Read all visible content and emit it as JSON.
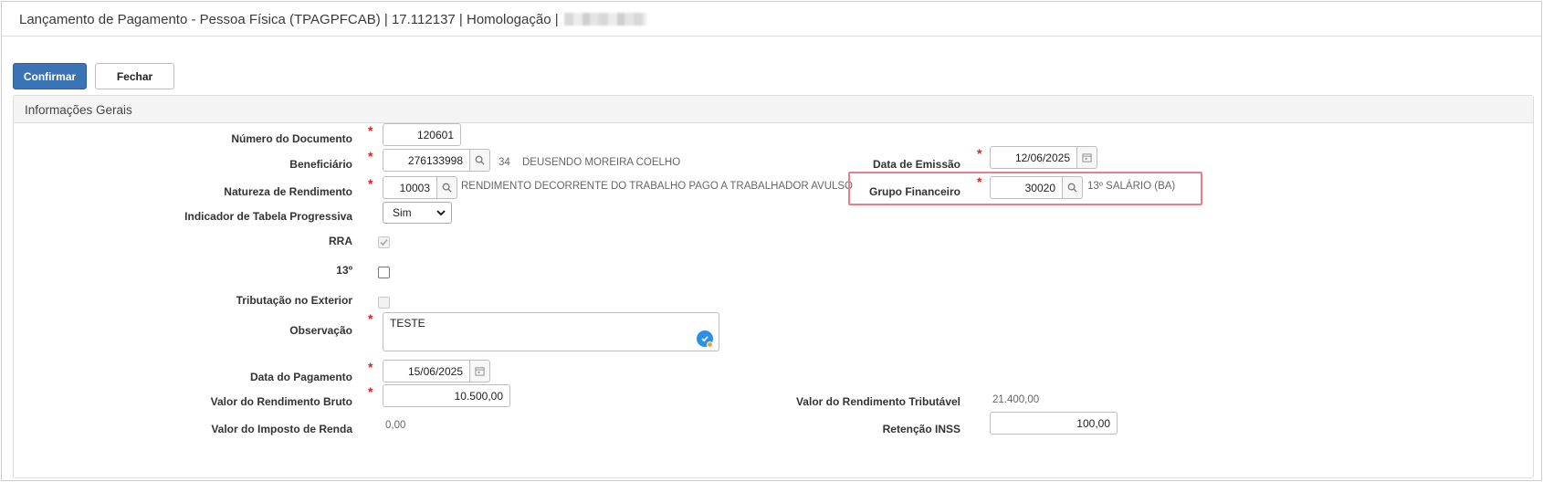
{
  "window": {
    "title": "Lançamento de Pagamento - Pessoa Física (TPAGPFCAB) | 17.112137 | Homologação |"
  },
  "toolbar": {
    "confirm_label": "Confirmar",
    "close_label": "Fechar"
  },
  "panel": {
    "title": "Informações Gerais"
  },
  "form": {
    "numero_documento": {
      "label": "Número do Documento",
      "value": "120601"
    },
    "beneficiario": {
      "label": "Beneficiário",
      "value": "276133998",
      "code": "34",
      "name": "DEUSENDO MOREIRA COELHO"
    },
    "natureza_rendimento": {
      "label": "Natureza de Rendimento",
      "value": "10003",
      "description": "RENDIMENTO DECORRENTE DO TRABALHO PAGO A TRABALHADOR AVULSO"
    },
    "indicador_tabela": {
      "label": "Indicador de Tabela Progressiva",
      "selected": "Sim"
    },
    "rra": {
      "label": "RRA",
      "checked": true,
      "disabled": true
    },
    "decimo_terceiro": {
      "label": "13º",
      "checked": false
    },
    "tributacao_exterior": {
      "label": "Tributação no Exterior",
      "checked": false,
      "disabled": true
    },
    "observacao": {
      "label": "Observação",
      "value": "TESTE"
    },
    "data_pagamento": {
      "label": "Data do Pagamento",
      "value": "15/06/2025"
    },
    "valor_rendimento_bruto": {
      "label": "Valor do Rendimento Bruto",
      "value": "10.500,00"
    },
    "valor_imposto_renda": {
      "label": "Valor do Imposto de Renda",
      "value": "0,00"
    },
    "data_emissao": {
      "label": "Data de Emissão",
      "value": "12/06/2025"
    },
    "grupo_financeiro": {
      "label": "Grupo Financeiro",
      "value": "30020",
      "description": "13º SALÁRIO (BA)"
    },
    "valor_rendimento_tributavel": {
      "label": "Valor do Rendimento Tributável",
      "value": "21.400,00"
    },
    "retencao_inss": {
      "label": "Retenção INSS",
      "value": "100,00"
    }
  },
  "required_marker": "*",
  "colors": {
    "primary": "#3a73b6",
    "required": "#e02020",
    "highlight": "#e97f86"
  },
  "icons": [
    "search-icon",
    "calendar-icon",
    "chevron-down-icon",
    "spellcheck-icon",
    "check-icon"
  ]
}
